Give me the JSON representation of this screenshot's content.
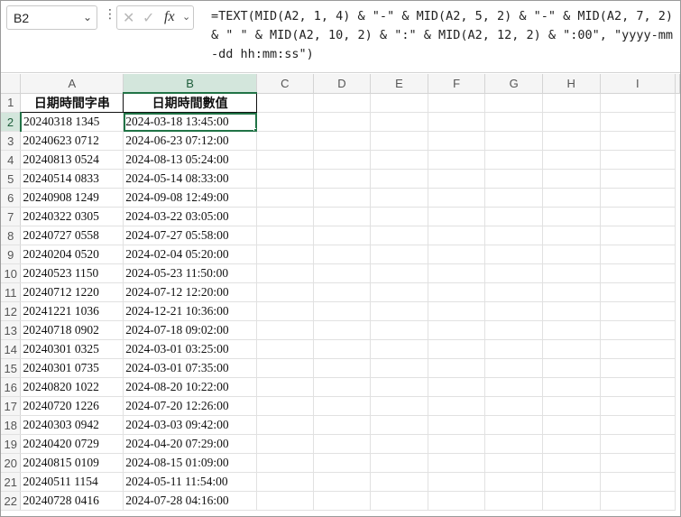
{
  "formula_bar": {
    "name_box": "B2",
    "formula": "=TEXT(MID(A2, 1, 4) & \"-\" & MID(A2, 5, 2) & \"-\" & MID(A2, 7, 2) & \" \" & MID(A2, 10, 2) & \":\" & MID(A2, 12, 2) & \":00\", \"yyyy-mm-dd hh:mm:ss\")"
  },
  "columns": [
    "A",
    "B",
    "C",
    "D",
    "E",
    "F",
    "G",
    "H",
    "I"
  ],
  "header_row": {
    "row": "1",
    "a": "日期時間字串",
    "b": "日期時間數值"
  },
  "rows": [
    {
      "n": "2",
      "a": "20240318 1345",
      "b": "2024-03-18 13:45:00"
    },
    {
      "n": "3",
      "a": "20240623 0712",
      "b": "2024-06-23 07:12:00"
    },
    {
      "n": "4",
      "a": "20240813 0524",
      "b": "2024-08-13 05:24:00"
    },
    {
      "n": "5",
      "a": "20240514 0833",
      "b": "2024-05-14 08:33:00"
    },
    {
      "n": "6",
      "a": "20240908 1249",
      "b": "2024-09-08 12:49:00"
    },
    {
      "n": "7",
      "a": "20240322 0305",
      "b": "2024-03-22 03:05:00"
    },
    {
      "n": "8",
      "a": "20240727 0558",
      "b": "2024-07-27 05:58:00"
    },
    {
      "n": "9",
      "a": "20240204 0520",
      "b": "2024-02-04 05:20:00"
    },
    {
      "n": "10",
      "a": "20240523 1150",
      "b": "2024-05-23 11:50:00"
    },
    {
      "n": "11",
      "a": "20240712 1220",
      "b": "2024-07-12 12:20:00"
    },
    {
      "n": "12",
      "a": "20241221 1036",
      "b": "2024-12-21 10:36:00"
    },
    {
      "n": "13",
      "a": "20240718 0902",
      "b": "2024-07-18 09:02:00"
    },
    {
      "n": "14",
      "a": "20240301 0325",
      "b": "2024-03-01 03:25:00"
    },
    {
      "n": "15",
      "a": "20240301 0735",
      "b": "2024-03-01 07:35:00"
    },
    {
      "n": "16",
      "a": "20240820 1022",
      "b": "2024-08-20 10:22:00"
    },
    {
      "n": "17",
      "a": "20240720 1226",
      "b": "2024-07-20 12:26:00"
    },
    {
      "n": "18",
      "a": "20240303 0942",
      "b": "2024-03-03 09:42:00"
    },
    {
      "n": "19",
      "a": "20240420 0729",
      "b": "2024-04-20 07:29:00"
    },
    {
      "n": "20",
      "a": "20240815 0109",
      "b": "2024-08-15 01:09:00"
    },
    {
      "n": "21",
      "a": "20240511 1154",
      "b": "2024-05-11 11:54:00"
    },
    {
      "n": "22",
      "a": "20240728 0416",
      "b": "2024-07-28 04:16:00"
    }
  ]
}
